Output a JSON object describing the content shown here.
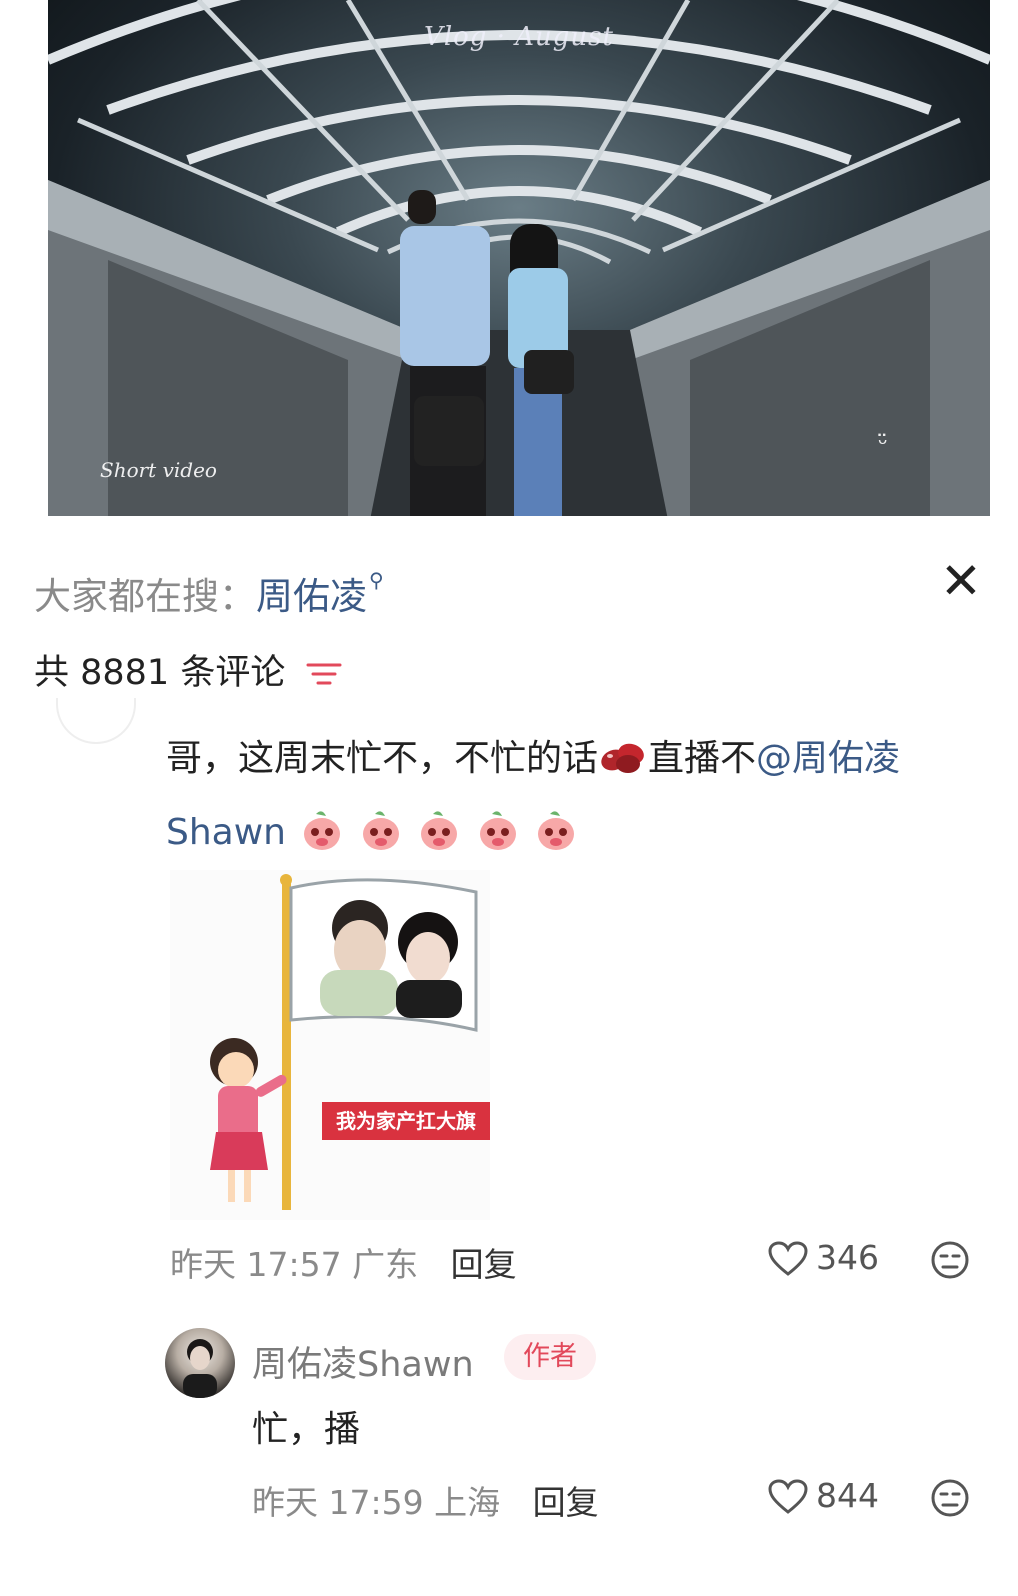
{
  "video": {
    "title": "Vlog · August",
    "watermark": "Short video",
    "smile": "ᵕ̈"
  },
  "search": {
    "prefix": "大家都在搜：",
    "keyword": "周佑凌",
    "icon": "search-icon"
  },
  "close_icon": "✕",
  "comment_count_label": "共 8881 条评论",
  "comment": {
    "text_part1": "哥，这周末忙不，不忙的话",
    "text_part2": "直播不",
    "mention": "@周佑凌Shawn",
    "sticker_caption": "我为家产扛大旗",
    "time": "昨天 17:57",
    "location": "广东",
    "reply_label": "回复",
    "likes": "346"
  },
  "reply": {
    "username": "周佑凌Shawn",
    "badge": "作者",
    "text": "忙，播",
    "time": "昨天 17:59",
    "location": "上海",
    "reply_label": "回复",
    "likes": "844"
  },
  "colors": {
    "link": "#3b5a86",
    "badge_bg": "#fdeef0",
    "badge_text": "#e2495b",
    "filter": "#e2495b"
  }
}
